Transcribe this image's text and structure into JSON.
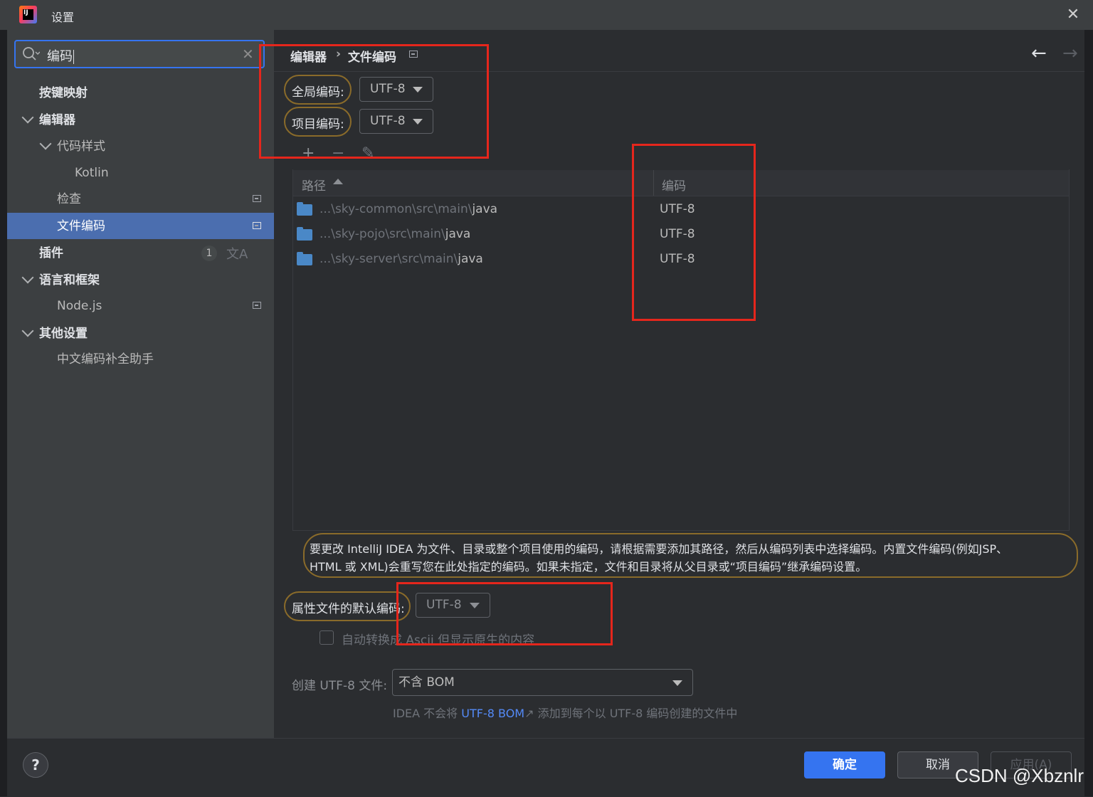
{
  "window": {
    "title": "设置",
    "close_icon": "close-icon"
  },
  "search": {
    "value": "编码"
  },
  "sidebar": {
    "items": [
      {
        "label": "按键映射"
      },
      {
        "label": "编辑器"
      },
      {
        "label": "代码样式"
      },
      {
        "label": "Kotlin"
      },
      {
        "label": "检查"
      },
      {
        "label": "文件编码"
      },
      {
        "label": "插件",
        "badge": "1"
      },
      {
        "label": "语言和框架"
      },
      {
        "label": "Node.js"
      },
      {
        "label": "其他设置"
      },
      {
        "label": "中文编码补全助手"
      }
    ],
    "selected": "文件编码"
  },
  "breadcrumb": {
    "parent": "编辑器",
    "separator": "›",
    "current": "文件编码"
  },
  "encoding": {
    "global_label": "全局编码:",
    "global_value": "UTF-8",
    "project_label": "项目编码:",
    "project_value": "UTF-8"
  },
  "table": {
    "toolbar": {
      "add": "+",
      "remove": "−",
      "edit": "✎"
    },
    "columns": [
      "路径",
      "编码"
    ],
    "rows": [
      {
        "prefix": "...\\sky-common\\src\\main\\",
        "tail": "java",
        "encoding": "UTF-8"
      },
      {
        "prefix": "...\\sky-pojo\\src\\main\\",
        "tail": "java",
        "encoding": "UTF-8"
      },
      {
        "prefix": "...\\sky-server\\src\\main\\",
        "tail": "java",
        "encoding": "UTF-8"
      }
    ]
  },
  "info": {
    "line1": "要更改 IntelliJ IDEA 为文件、目录或整个项目使用的编码，请根据需要添加其路径，然后从编码列表中选择编码。内置文件编码(例如JSP、",
    "line2": "HTML 或 XML)会重写您在此处指定的编码。如果未指定，文件和目录将从父目录或“项目编码”继承编码设置。"
  },
  "properties": {
    "label": "属性文件的默认编码:",
    "value": "UTF-8",
    "ascii_checkbox": "自动转换成 Ascii 但显示原生的内容",
    "ascii_checked": false
  },
  "bom": {
    "label": "创建 UTF-8 文件:",
    "value": "不含 BOM",
    "hint_prefix": "IDEA 不会将",
    "hint_link": "UTF-8 BOM",
    "hint_arrow": "↗",
    "hint_suffix": "添加到每个以 UTF-8 编码创建的文件中"
  },
  "footer": {
    "help": "?",
    "ok": "确定",
    "cancel": "取消",
    "apply": "应用(A)"
  },
  "watermark": "CSDN @Xbznlr",
  "colors": {
    "accent": "#3574f0",
    "selection": "#4b6eaf",
    "annotation_red": "#e5261c",
    "link": "#548af7"
  }
}
